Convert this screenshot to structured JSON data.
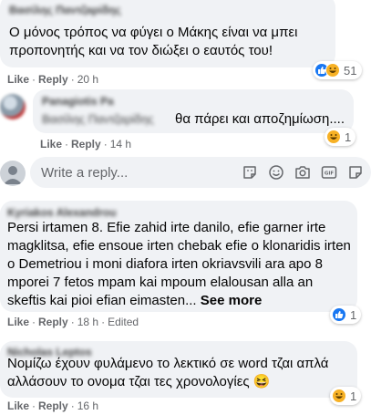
{
  "comments": [
    {
      "author": "Βασίλης Παντζαρίδης",
      "text": "Ο μόνος τρόπος να φύγει ο Μάκης είναι να μπει προπονητής και να τον διώξει ο εαυτός του!",
      "actions": {
        "like": "Like",
        "reply": "Reply",
        "time": "20 h"
      },
      "reactions": {
        "count": "51",
        "types": [
          "like",
          "haha"
        ]
      }
    },
    {
      "author": "Panagiotis Pa",
      "tag": "Βασίλης Παντζαρίδης",
      "text": "θα πάρει και αποζημίωση....",
      "actions": {
        "like": "Like",
        "reply": "Reply",
        "time": "14 h"
      },
      "reactions": {
        "count": "1",
        "types": [
          "haha"
        ]
      }
    },
    {
      "author": "Kyriakos Alexandrou",
      "text": "Persi irtamen 8. Efie zahid irte danilo, efie garner irte magklitsa, efie ensoue irten chebak efie o klonaridis irten o Demetriou i moni diafora irten okriavsvili ara apo 8 mporei 7 fetos mpam kai mpoum elalousan alla an skeftis kai pioi efian eimasten...",
      "see_more": "See more",
      "actions": {
        "like": "Like",
        "reply": "Reply",
        "time": "18 h",
        "edited": "Edited"
      },
      "reactions": {
        "count": "1",
        "types": [
          "like"
        ]
      }
    },
    {
      "author": "Nicholas Leptos",
      "text": "Νομίζω έχουν φυλάμενο το λεκτικό σε word τζαι απλά αλλάσουν το ονομα τζαι τες χρονολογίες 😆",
      "actions": {
        "like": "Like",
        "reply": "Reply",
        "time": "16 h"
      },
      "reactions": {
        "count": "1",
        "types": [
          "haha"
        ]
      }
    }
  ],
  "reply_box": {
    "placeholder": "Write a reply...",
    "icons": [
      "sticker-face-icon",
      "emoji-icon",
      "camera-icon",
      "gif-icon",
      "sticker-icon"
    ]
  },
  "colors": {
    "bubble": "#f0f2f5",
    "meta_text": "#65676b",
    "like_blue": "#1877f2",
    "haha_yellow": "#f7b125"
  }
}
